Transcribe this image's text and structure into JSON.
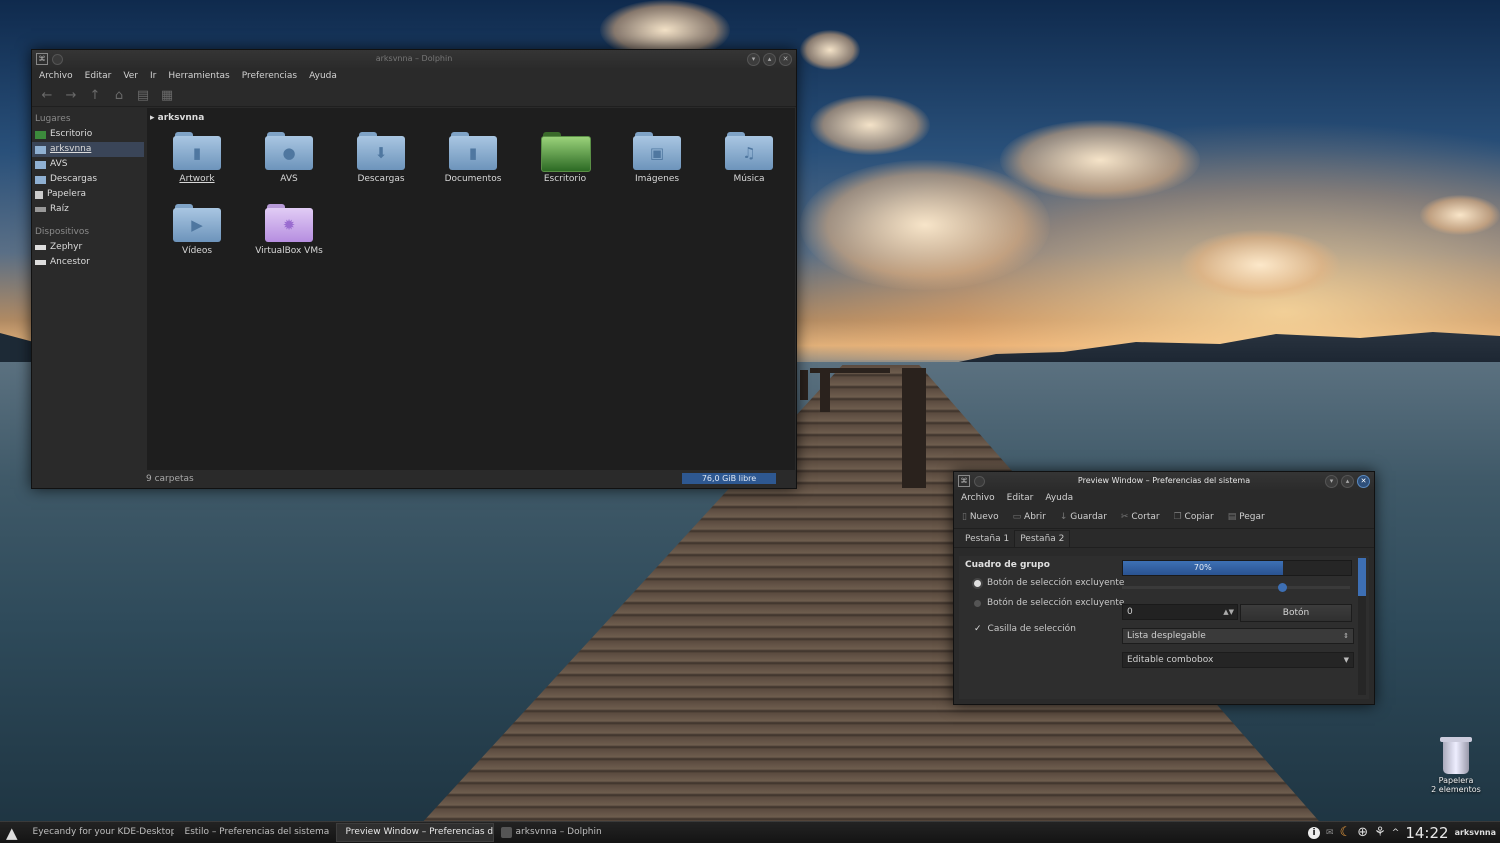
{
  "dolphin": {
    "title": "arksvnna – Dolphin",
    "menu": [
      "Archivo",
      "Editar",
      "Ver",
      "Ir",
      "Herramientas",
      "Preferencias",
      "Ayuda"
    ],
    "places_header": "Lugares",
    "places": [
      "Escritorio",
      "arksvnna",
      "AVS",
      "Descargas",
      "Papelera",
      "Raíz"
    ],
    "devices_header": "Dispositivos",
    "devices": [
      "Zephyr",
      "Ancestor"
    ],
    "breadcrumb": "arksvnna",
    "folders": [
      "Artwork",
      "AVS",
      "Descargas",
      "Documentos",
      "Escritorio",
      "Imágenes",
      "Música",
      "Vídeos",
      "VirtualBox VMs"
    ],
    "status": "9 carpetas",
    "free_space": "76,0 GiB libre",
    "free_fraction": 1.0
  },
  "preview": {
    "title": "Preview Window – Preferencias del sistema",
    "menu": [
      "Archivo",
      "Editar",
      "Ayuda"
    ],
    "toolbar": [
      "Nuevo",
      "Abrir",
      "Guardar",
      "Cortar",
      "Copiar",
      "Pegar"
    ],
    "tabs": [
      "Pestaña 1",
      "Pestaña 2"
    ],
    "group_title": "Cuadro de grupo",
    "radio1": "Botón de selección excluyente",
    "radio2": "Botón de selección excluyente",
    "checkbox": "Casilla de selección",
    "progress_label": "70%",
    "progress": 0.7,
    "slider": 0.7,
    "spin_value": "0",
    "button": "Botón",
    "combo1": "Lista desplegable",
    "combo2": "Editable combobox"
  },
  "desktop": {
    "trash_label": "Papelera",
    "trash_count": "2 elementos"
  },
  "taskbar": {
    "tasks": [
      "Eyecandy for your KDE-Desktop",
      "Estilo – Preferencias del sistema",
      "Preview Window – Preferencias d",
      "arksvnna – Dolphin"
    ],
    "clock": "14:22",
    "user": "arksvnna"
  },
  "colors": {
    "accent": "#2e5891",
    "selection": "#3a4558",
    "window_bg": "#2a2a2a"
  }
}
